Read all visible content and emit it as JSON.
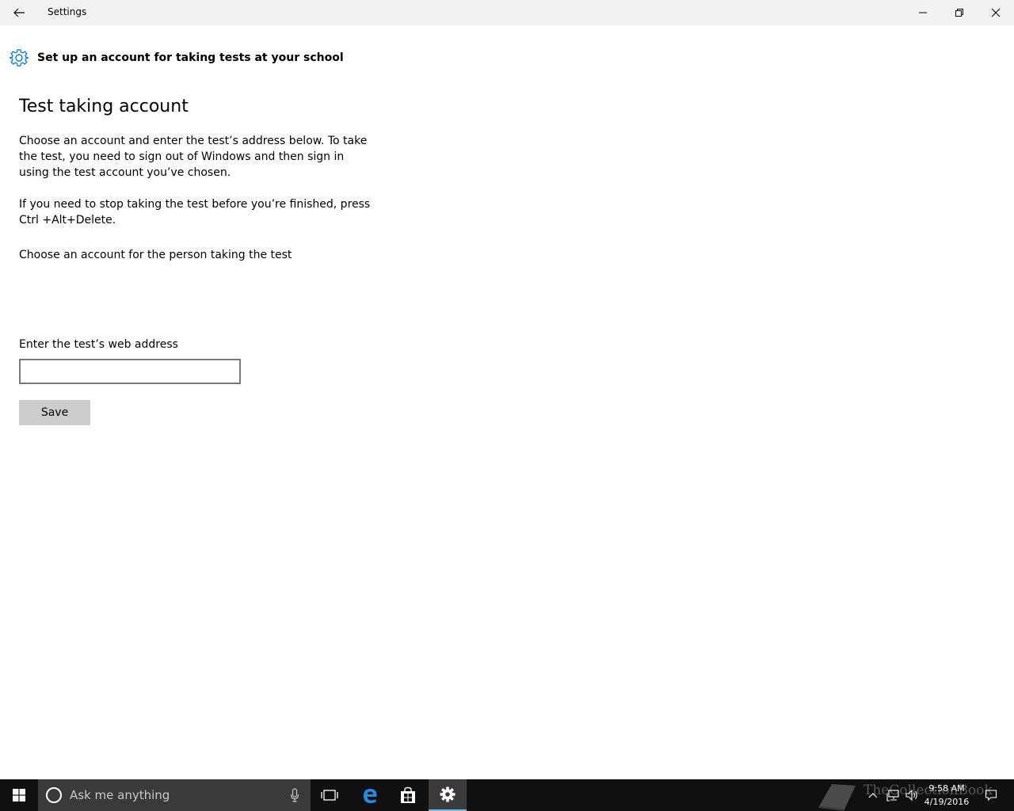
{
  "window": {
    "title": "Settings"
  },
  "header": {
    "title": "Set up an account for taking tests at your school"
  },
  "main": {
    "heading": "Test taking account",
    "paragraph1": "Choose an account and enter the test’s address below. To take the test, you need to sign out of Windows and then sign in using the test account you’ve chosen.",
    "paragraph2": "If you need to stop taking the test before you’re finished, press Ctrl +Alt+Delete.",
    "choose_account_label": "Choose an account for the person taking the test",
    "web_address_label": "Enter the test’s web address",
    "web_address_value": "",
    "save_label": "Save"
  },
  "taskbar": {
    "search_placeholder": "Ask me anything",
    "clock_time": "9:58 AM",
    "clock_date": "4/19/2016",
    "watermark": "TheCollectionBook",
    "icons": [
      "windows-start-icon",
      "cortana-icon",
      "microphone-icon",
      "task-view-icon",
      "edge-icon",
      "store-icon",
      "settings-icon",
      "chevron-up-icon",
      "network-icon",
      "volume-icon",
      "action-center-icon"
    ]
  },
  "colors": {
    "accent": "#0078d7",
    "titlebar_bg": "#f2f2f2",
    "taskbar_bg": "#101010",
    "button_bg": "#cccccc"
  }
}
